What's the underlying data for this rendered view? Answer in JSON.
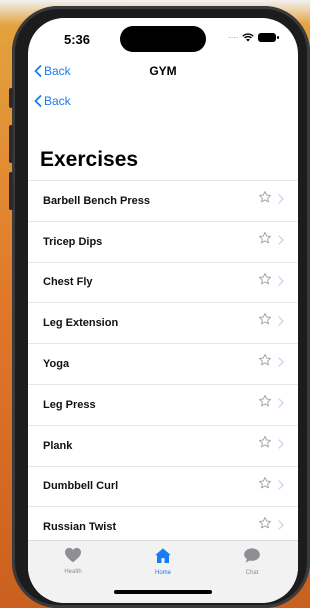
{
  "status_bar": {
    "time": "5:36"
  },
  "navigation": {
    "back_label": "Back",
    "title": "GYM",
    "second_back_label": "Back"
  },
  "page_title": "Exercises",
  "exercises": [
    {
      "name": "Barbell Bench Press"
    },
    {
      "name": "Tricep Dips"
    },
    {
      "name": "Chest Fly"
    },
    {
      "name": "Leg Extension"
    },
    {
      "name": "Yoga"
    },
    {
      "name": "Leg Press"
    },
    {
      "name": "Plank"
    },
    {
      "name": "Dumbbell Curl"
    },
    {
      "name": "Russian Twist"
    }
  ],
  "tab_bar": {
    "tabs": [
      {
        "label": "Health",
        "icon": "heart-icon",
        "active": false
      },
      {
        "label": "Home",
        "icon": "home-icon",
        "active": true
      },
      {
        "label": "Chat",
        "icon": "chat-bubble-icon",
        "active": false
      }
    ]
  },
  "colors": {
    "accent": "#1a7cf5",
    "inactive_tab": "#8e8e93",
    "star": "#a0a0a0",
    "chevron": "#c7d8ef"
  }
}
